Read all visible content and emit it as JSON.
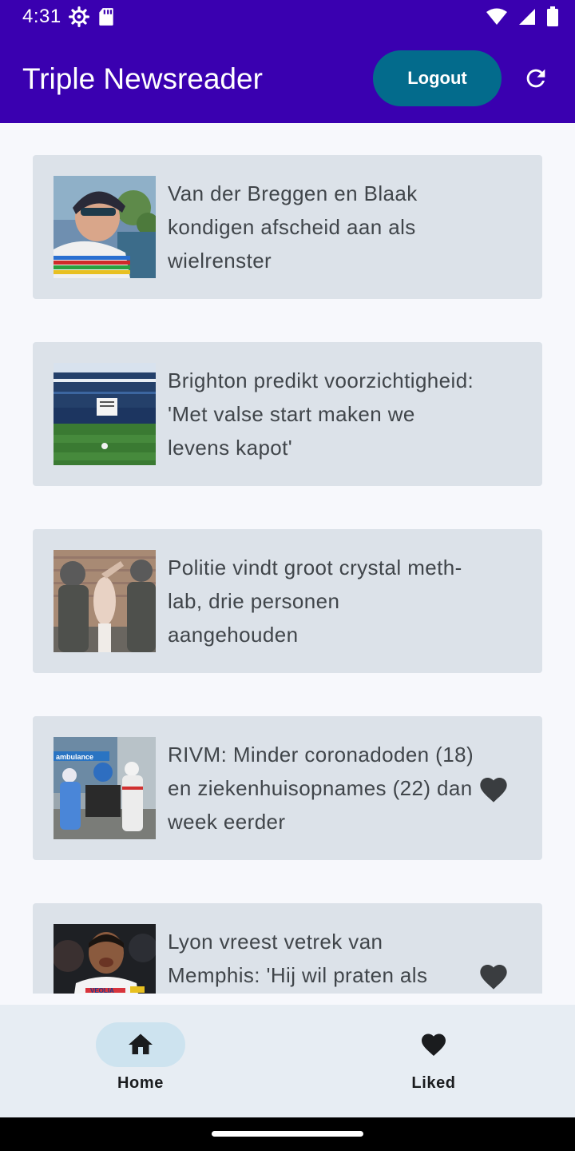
{
  "status_bar": {
    "time": "4:31",
    "icons": [
      "gear-icon",
      "sd-card-icon",
      "wifi-icon",
      "signal-icon",
      "battery-icon"
    ]
  },
  "app_bar": {
    "title": "Triple Newsreader",
    "logout_label": "Logout",
    "refresh_icon": "refresh-icon"
  },
  "colors": {
    "app_bar": "#3a00b0",
    "logout_button": "#036b8c",
    "card_background": "#dce2e9",
    "nav_background": "#e7edf3",
    "nav_active_pill": "#cde3ef"
  },
  "articles": [
    {
      "title": "Van der Breggen en Blaak kondigen afscheid aan als wielrenster",
      "liked": false,
      "thumbnail": "cyclist-photo"
    },
    {
      "title": "Brighton predikt voorzichtigheid: 'Met valse start maken we levens kapot'",
      "liked": false,
      "thumbnail": "stadium-photo"
    },
    {
      "title": "Politie vindt groot crystal meth-lab, drie personen aangehouden",
      "liked": false,
      "thumbnail": "police-photo"
    },
    {
      "title": "RIVM: Minder coronadoden (18) en ziekenhuisopnames (22) dan week eerder",
      "liked": true,
      "thumbnail": "ambulance-photo",
      "thumbnail_text": "ambulance"
    },
    {
      "title": "Lyon vreest vetrek van Memphis: 'Hij wil praten als",
      "liked": true,
      "thumbnail": "footballer-photo",
      "thumbnail_text": "VEOLIA"
    }
  ],
  "bottom_nav": {
    "items": [
      {
        "label": "Home",
        "icon": "home-icon",
        "active": true
      },
      {
        "label": "Liked",
        "icon": "heart-icon",
        "active": false
      }
    ]
  }
}
